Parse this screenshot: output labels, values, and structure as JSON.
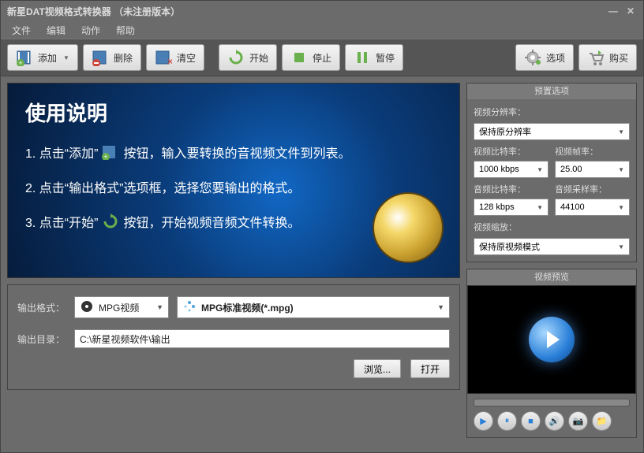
{
  "title": "新星DAT视频格式转换器 （未注册版本）",
  "menus": [
    "文件",
    "编辑",
    "动作",
    "帮助"
  ],
  "toolbar": {
    "add": "添加",
    "delete": "删除",
    "clear": "清空",
    "start": "开始",
    "stop": "停止",
    "pause": "暂停",
    "options": "选项",
    "buy": "购买"
  },
  "banner": {
    "heading": "使用说明",
    "s1a": "1. 点击“添加”",
    "s1b": "按钮，输入要转换的音视频文件到列表。",
    "s2": "2. 点击“输出格式”选项框，选择您要输出的格式。",
    "s3a": "3. 点击“开始”",
    "s3b": "按钮，开始视频音频文件转换。"
  },
  "form": {
    "output_format_label": "输出格式：",
    "format1": "MPG视频",
    "format2": "MPG标准视频(*.mpg)",
    "output_dir_label": "输出目录：",
    "output_dir": "C:\\新星视频软件\\输出",
    "browse": "浏览...",
    "open": "打开"
  },
  "preset": {
    "header": "预置选项",
    "res_label": "视频分辨率：",
    "res_value": "保持原分辨率",
    "vbitrate_label": "视频比特率：",
    "vbitrate_value": "1000 kbps",
    "vfps_label": "视频帧率：",
    "vfps_value": "25.00",
    "abitrate_label": "音频比特率：",
    "abitrate_value": "128 kbps",
    "asample_label": "音频采样率：",
    "asample_value": "44100",
    "scale_label": "视频缩放：",
    "scale_value": "保持原视频模式"
  },
  "preview": {
    "header": "视频预览"
  }
}
